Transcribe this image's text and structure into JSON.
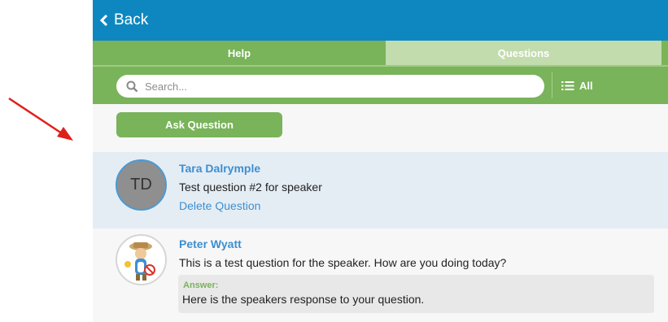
{
  "header": {
    "back_label": "Back",
    "back_icon": "chevron-left-icon"
  },
  "tabs": [
    {
      "label": "Help",
      "active": false
    },
    {
      "label": "Questions",
      "active": true
    }
  ],
  "search": {
    "placeholder": "Search...",
    "value": ""
  },
  "filter": {
    "label": "All",
    "icon": "list-icon"
  },
  "ask_button": {
    "label": "Ask Question"
  },
  "questions": [
    {
      "author": "Tara Dalrymple",
      "avatar_initials": "TD",
      "text": "Test question #2 for speaker",
      "action": "Delete Question"
    },
    {
      "author": "Peter Wyatt",
      "avatar_icon": "mascot-avatar-icon",
      "text": "This is a test question for the speaker. How are you doing today?",
      "answer_label": "Answer:",
      "answer_text": "Here is the speakers response to your question."
    }
  ],
  "colors": {
    "header_blue": "#0e87c0",
    "tab_green": "#79b35a",
    "tab_active": "#c2dcae",
    "link_blue": "#3d8fd1",
    "annotation_arrow": "#e0201b"
  }
}
